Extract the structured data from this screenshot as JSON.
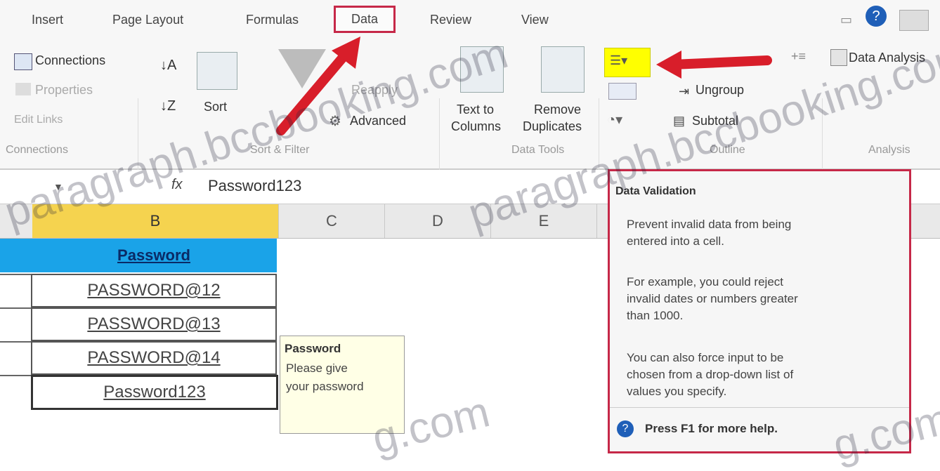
{
  "ribbon_tabs": [
    "Insert",
    "Page Layout",
    "Formulas",
    "Data",
    "Review",
    "View"
  ],
  "connections": {
    "connections": "Connections",
    "properties": "Properties",
    "edit_links": "Edit Links",
    "group": "Connections"
  },
  "sort_filter": {
    "sort": "Sort",
    "advanced": "Advanced",
    "reapply": "Reapply",
    "group": "Sort & Filter"
  },
  "data_tools": {
    "text_to_columns_1": "Text to",
    "text_to_columns_2": "Columns",
    "remove_duplicates_1": "Remove",
    "remove_duplicates_2": "Duplicates",
    "group": "Data Tools"
  },
  "outline": {
    "ungroup": "Ungroup",
    "subtotal": "Subtotal",
    "group": "Outline"
  },
  "analysis": {
    "data_analysis": "Data Analysis",
    "group": "Analysis"
  },
  "formula_bar": {
    "fx": "fx",
    "value": "Password123"
  },
  "columns": [
    "B",
    "C",
    "D",
    "E"
  ],
  "cells": {
    "header": "Password",
    "rows": [
      "PASSWORD@12",
      "PASSWORD@13",
      "PASSWORD@14",
      "Password123"
    ]
  },
  "input_message": {
    "title": "Password",
    "body_1": "Please give",
    "body_2": "your password"
  },
  "tooltip": {
    "title": "Data Validation",
    "p1_1": "Prevent invalid data from being",
    "p1_2": "entered into a cell.",
    "p2_1": "For example, you could reject",
    "p2_2": "invalid dates or numbers greater",
    "p2_3": "than 1000.",
    "p3_1": "You can also force input to be",
    "p3_2": "chosen from a drop-down list of",
    "p3_3": "values you specify.",
    "help": "Press F1 for more help."
  },
  "watermark": [
    "paragraph.bccbooking.com",
    "paragraph.bccbooking.com",
    "g.com",
    "g.com"
  ],
  "colors": {
    "accent_red": "#c62848",
    "header_blue": "#1aa3e8",
    "selected_col": "#f5d34f",
    "highlight_yellow": "#ffff00"
  }
}
